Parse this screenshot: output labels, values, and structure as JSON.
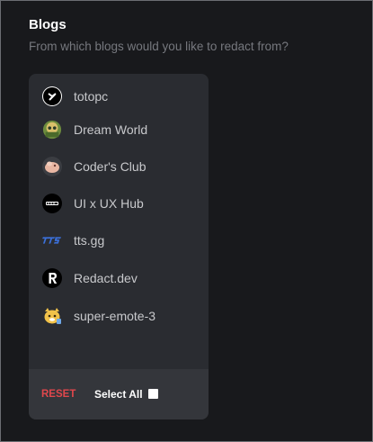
{
  "header": {
    "title": "Blogs",
    "subtitle": "From which blogs would you like to redact from?"
  },
  "blogs": [
    {
      "label": "totopc",
      "icon": "totopc-logo-icon",
      "color": "#000000"
    },
    {
      "label": "Dream World",
      "icon": "dream-world-logo-icon",
      "color": "#5c7a3a"
    },
    {
      "label": "Coder's Club",
      "icon": "coders-club-logo-icon",
      "color": "#e9b7a3"
    },
    {
      "label": "UI x UX Hub",
      "icon": "ui-ux-hub-logo-icon",
      "color": "#000000"
    },
    {
      "label": "tts.gg",
      "icon": "tts-gg-logo-icon",
      "color": "#3b6fd8"
    },
    {
      "label": "Redact.dev",
      "icon": "redact-dev-logo-icon",
      "color": "#000000"
    },
    {
      "label": "super-emote-3",
      "icon": "super-emote-logo-icon",
      "color": "#f1c24a"
    }
  ],
  "footer": {
    "reset_label": "RESET",
    "select_all_label": "Select All",
    "select_all_checked": false
  },
  "colors": {
    "background": "#18191c",
    "panel": "#2a2c31",
    "footer": "#34363b",
    "reset": "#e0474c",
    "subtitle": "#76787e"
  }
}
